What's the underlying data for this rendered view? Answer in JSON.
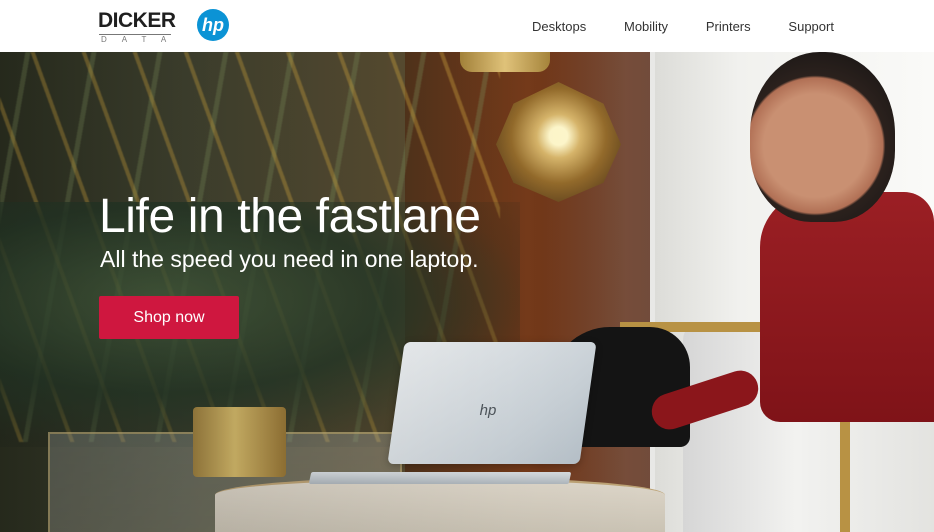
{
  "brand": {
    "dicker_top": "DICKER",
    "dicker_bottom": "DATA",
    "hp_logo": "hp"
  },
  "nav": {
    "items": [
      "Desktops",
      "Mobility",
      "Printers",
      "Support"
    ]
  },
  "hero": {
    "title": "Life in the fastlane",
    "subtitle": "All the speed you need in one laptop.",
    "cta_label": "Shop now",
    "laptop_logo": "hp"
  },
  "colors": {
    "accent": "#cf173f",
    "hp_blue": "#0b93d5"
  },
  "icons": {
    "brand_mark": "dicker-data-logo",
    "partner_mark": "hp-logo"
  }
}
